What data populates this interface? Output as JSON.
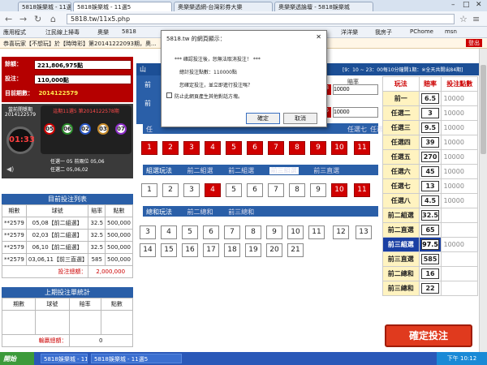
{
  "browser": {
    "tabs": [
      "5818娛樂城 - 11選5",
      "5818娛樂城 - 11選5",
      "奧樂樂透網-台灣彩券大樂",
      "奧樂樂透論壇 - 5818娛樂城"
    ],
    "url": "5818.tw/11x5.php",
    "bookmarks": [
      "應用程式",
      "江民線上掃毒",
      "奧樂",
      "5818",
      "洋洋樂",
      "我房子",
      "PChome",
      "msn"
    ],
    "logout": "登出",
    "announcement": "恭喜玩家【不想玩】於【時時彩】第20141222093期，奧..."
  },
  "left": {
    "total_label": "餘額：",
    "total_value": "221,806,975點",
    "bet_label": "投注：",
    "bet_value": "110,000點",
    "period_label": "目前期數：",
    "period_value": "2014122579",
    "draw_time_label": "當前開獎期",
    "draw_time_value": "2014122579",
    "countdown": "01:33",
    "last_draw_label": "這期11選5 第2014122578期",
    "balls": [
      "05",
      "06",
      "02",
      "03",
      "07"
    ],
    "info1": "任選一 05   前兩位 05,06",
    "info2": "任選二 05,06,02"
  },
  "bet_list": {
    "title": "目前投注列表",
    "headers": [
      "期數",
      "球號",
      "賠率",
      "點數"
    ],
    "rows": [
      [
        "**2579",
        "05,08【前二組選】",
        "32.5",
        "500,000"
      ],
      [
        "**2579",
        "02,03【前二組選】",
        "32.5",
        "500,000"
      ],
      [
        "**2579",
        "06,10【前二組選】",
        "32.5",
        "500,000"
      ],
      [
        "**2579",
        "03,06,11【前三直選】",
        "585",
        "500,000"
      ]
    ],
    "total_label": "投注總額：",
    "total_value": "2,000,000"
  },
  "prev_list": {
    "title": "上期投注單統計",
    "headers": [
      "期數",
      "球號",
      "賠率",
      "點數"
    ],
    "total_label": "輸贏總額：",
    "total_value": "0"
  },
  "main": {
    "header_text": "[9：10 ~ 23：00每10分鐘開1期：※全天共開出84期]",
    "odds_label": "賠率",
    "odds_inputs": [
      "10000",
      "10000"
    ],
    "odds_prefix": [
      "3",
      "5"
    ],
    "left_tabs": [
      "山",
      "前",
      "前"
    ],
    "ren_tabs": [
      "任",
      "任選七",
      "任選八"
    ],
    "sel_numbers": [
      "1",
      "2",
      "3",
      "4",
      "5",
      "6",
      "7",
      "8",
      "9",
      "10",
      "11"
    ],
    "group_bar": {
      "title": "組選玩法",
      "items": [
        "前二組選",
        "前二組選",
        "前三組選",
        "前三直選"
      ],
      "selected": 2
    },
    "group_numbers": [
      "1",
      "2",
      "3",
      "4",
      "5",
      "6",
      "7",
      "8",
      "9",
      "10",
      "11"
    ],
    "group_red": [
      3,
      9,
      10
    ],
    "sum_bar": {
      "title": "總和玩法",
      "items": [
        "前二總和",
        "前三總和"
      ]
    },
    "sum_numbers": [
      "3",
      "4",
      "5",
      "6",
      "7",
      "8",
      "9",
      "10",
      "11",
      "12",
      "13",
      "14",
      "15",
      "16",
      "17",
      "18",
      "19",
      "20",
      "21"
    ],
    "submit": "確定投注"
  },
  "rates": {
    "headers": [
      "玩法",
      "賠率",
      "投注點數"
    ],
    "rows": [
      {
        "name": "前一",
        "odds": "6.5",
        "amount": "10000"
      },
      {
        "name": "任選二",
        "odds": "3",
        "amount": "10000"
      },
      {
        "name": "任選三",
        "odds": "9.5",
        "amount": "10000"
      },
      {
        "name": "任選四",
        "odds": "39",
        "amount": "10000"
      },
      {
        "name": "任選五",
        "odds": "270",
        "amount": "10000"
      },
      {
        "name": "任選六",
        "odds": "45",
        "amount": "10000"
      },
      {
        "name": "任選七",
        "odds": "13",
        "amount": "10000"
      },
      {
        "name": "任選八",
        "odds": "4.5",
        "amount": "10000"
      },
      {
        "name": "前二組選",
        "odds": "32.5",
        "amount": ""
      },
      {
        "name": "前二直選",
        "odds": "65",
        "amount": ""
      },
      {
        "name": "前三組選",
        "odds": "97.5",
        "amount": "10000"
      },
      {
        "name": "前三直選",
        "odds": "585",
        "amount": ""
      },
      {
        "name": "前二總和",
        "odds": "16",
        "amount": ""
      },
      {
        "name": "前三總和",
        "odds": "22",
        "amount": ""
      }
    ],
    "highlight": 10
  },
  "dialog": {
    "title": "5818.tw 的網頁顯示：",
    "line1": "***  確認投注後，恕無法取消投注！  ***",
    "line2": "總計投注點數：110000點",
    "line3": "您確定投注，並立即進行投注嗎？",
    "checkbox": "防止此網頁產生其他對話方塊。",
    "ok": "確定",
    "cancel": "取消"
  },
  "taskbar": {
    "start": "開始",
    "tasks": [
      "5818娛樂城 - 11選5",
      "5818娛樂城 - 11選5"
    ],
    "clock": "下午 10:12"
  }
}
